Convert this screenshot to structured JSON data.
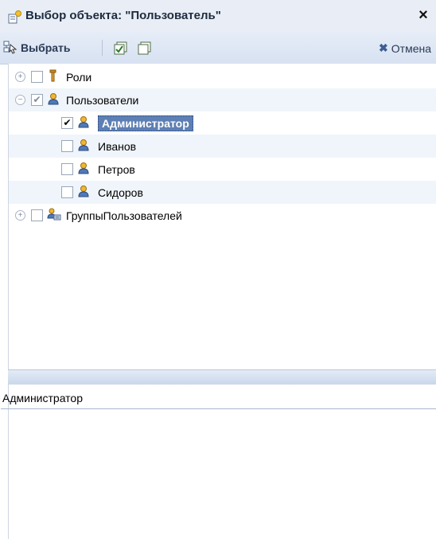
{
  "window": {
    "title": "Выбор объекта: \"Пользователь\"",
    "close_glyph": "×"
  },
  "toolbar": {
    "select_label": "Выбрать",
    "cancel_label": "Отмена",
    "cancel_glyph": "✖",
    "icons": [
      "select-icon",
      "check-all-icon",
      "uncheck-all-icon",
      "cancel-icon"
    ]
  },
  "tree": {
    "items": [
      {
        "label": "Роли",
        "level": 0,
        "expandable": true,
        "expanded": false,
        "checked": "none",
        "icon": "key-icon"
      },
      {
        "label": "Пользователи",
        "level": 0,
        "expandable": true,
        "expanded": true,
        "checked": "partial",
        "icon": "user-icon"
      },
      {
        "label": "Администратор",
        "level": 1,
        "expandable": false,
        "checked": "checked",
        "icon": "user-icon",
        "selected": true
      },
      {
        "label": "Иванов",
        "level": 1,
        "expandable": false,
        "checked": "none",
        "icon": "user-icon"
      },
      {
        "label": "Петров",
        "level": 1,
        "expandable": false,
        "checked": "none",
        "icon": "user-icon"
      },
      {
        "label": "Сидоров",
        "level": 1,
        "expandable": false,
        "checked": "none",
        "icon": "user-icon"
      },
      {
        "label": "ГруппыПользователей",
        "level": 0,
        "expandable": true,
        "expanded": false,
        "checked": "none",
        "icon": "user-group-icon"
      }
    ],
    "glyphs": {
      "collapsed": "+",
      "expanded": "−",
      "check": "✔"
    }
  },
  "detail": {
    "text": "Администратор"
  },
  "colors": {
    "title_bg": "#e9eef6",
    "toolbar_bg": "#dce5f4",
    "selection": "#5d7fb4",
    "alt_row": "#f0f5fb"
  }
}
